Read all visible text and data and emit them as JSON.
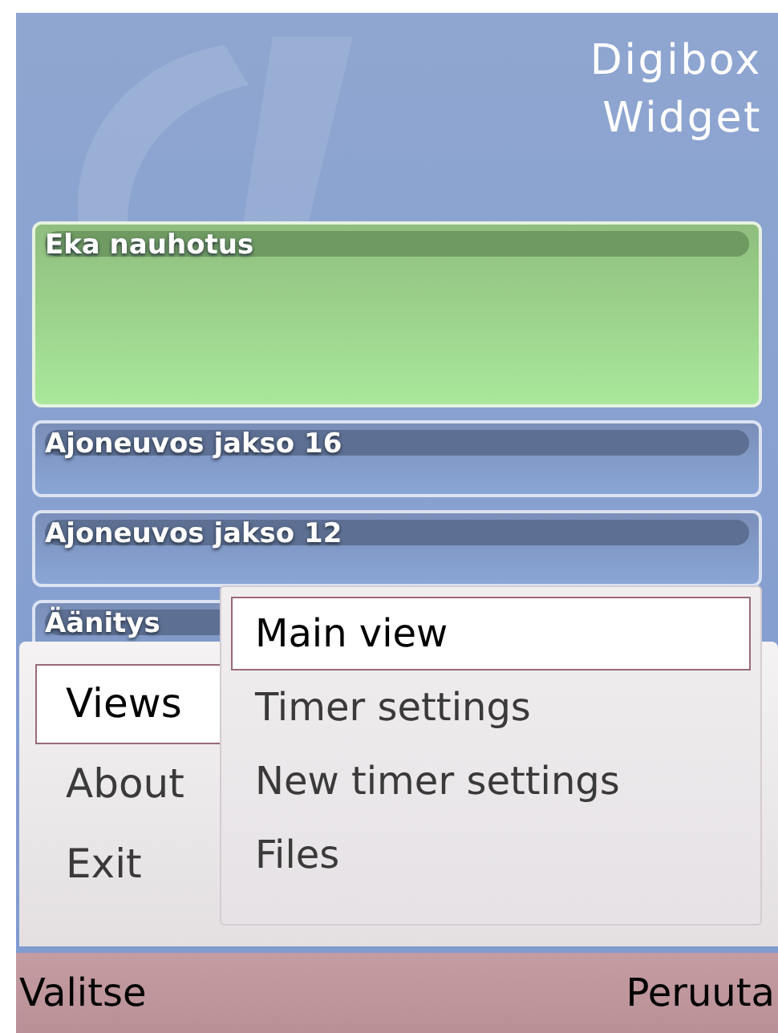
{
  "header": {
    "lines": [
      "Digibox",
      "Widget"
    ]
  },
  "recordings": [
    {
      "title": "Eka nauhotus",
      "selected": true
    },
    {
      "title": "Ajoneuvos jakso 16",
      "selected": false
    },
    {
      "title": "Ajoneuvos jakso 12",
      "selected": false
    },
    {
      "title": "Äänitys",
      "selected": false
    }
  ],
  "options_menu": {
    "items": [
      {
        "label": "Views",
        "selected": true
      },
      {
        "label": "About",
        "selected": false
      },
      {
        "label": "Exit",
        "selected": false
      }
    ]
  },
  "submenu": {
    "items": [
      {
        "label": "Main view",
        "selected": true
      },
      {
        "label": "Timer settings",
        "selected": false
      },
      {
        "label": "New timer settings",
        "selected": false
      },
      {
        "label": "Files",
        "selected": false
      }
    ]
  },
  "softkeys": {
    "left": "Valitse",
    "right": "Peruuta"
  }
}
